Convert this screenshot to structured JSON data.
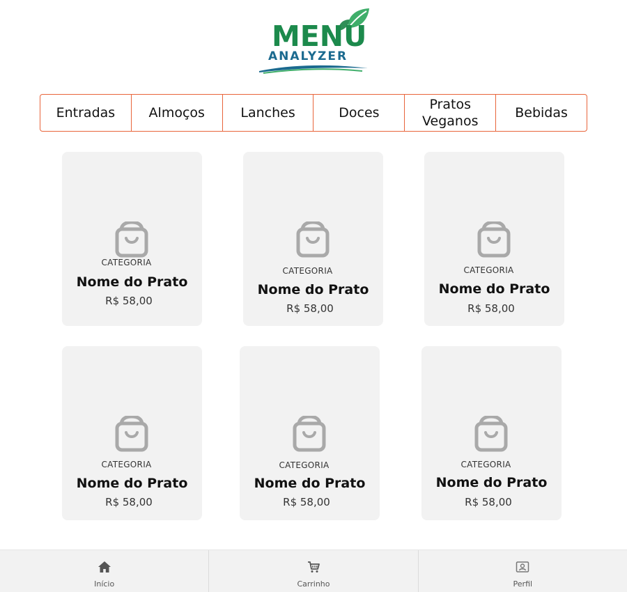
{
  "logo": {
    "word": "MENU",
    "sub": "ANALYZER",
    "colors": {
      "green": "#1c8a4c",
      "blue": "#1b6a8f",
      "leaf": "#3fae6a"
    }
  },
  "tabs": [
    {
      "label": "Entradas"
    },
    {
      "label": "Almoços"
    },
    {
      "label": "Lanches"
    },
    {
      "label": "Doces"
    },
    {
      "label": "Pratos Veganos"
    },
    {
      "label": "Bebidas"
    }
  ],
  "accent_color": "#e8643a",
  "products": [
    {
      "category": "CATEGORIA",
      "name": "Nome do Prato",
      "price": "R$ 58,00",
      "icon": "shopping-bag-icon"
    },
    {
      "category": "CATEGORIA",
      "name": "Nome do Prato",
      "price": "R$ 58,00",
      "icon": "shopping-bag-icon"
    },
    {
      "category": "CATEGORIA",
      "name": "Nome do Prato",
      "price": "R$ 58,00",
      "icon": "shopping-bag-icon"
    },
    {
      "category": "CATEGORIA",
      "name": "Nome do Prato",
      "price": "R$ 58,00",
      "icon": "shopping-bag-icon"
    },
    {
      "category": "CATEGORIA",
      "name": "Nome do Prato",
      "price": "R$ 58,00",
      "icon": "shopping-bag-icon"
    },
    {
      "category": "CATEGORIA",
      "name": "Nome do Prato",
      "price": "R$ 58,00",
      "icon": "shopping-bag-icon"
    }
  ],
  "bottom_nav": [
    {
      "label": "Início",
      "icon": "home-icon"
    },
    {
      "label": "Carrinho",
      "icon": "cart-icon"
    },
    {
      "label": "Perfil",
      "icon": "profile-icon"
    }
  ]
}
